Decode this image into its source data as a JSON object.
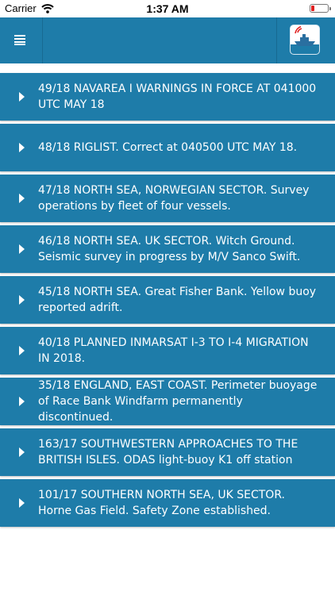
{
  "status": {
    "carrier": "Carrier",
    "time": "1:37 AM"
  },
  "navbar": {
    "menu_icon": "hamburger-menu-icon",
    "logo_icon": "ship-radio-logo-icon"
  },
  "colors": {
    "primary": "#1e7ca9",
    "text": "#ffffff",
    "background": "#ffffff",
    "battery_low": "#e02020"
  },
  "warnings": [
    {
      "text": "49/18 NAVAREA I WARNINGS IN FORCE AT 041000 UTC MAY 18"
    },
    {
      "text": "48/18 RIGLIST. Correct at 040500 UTC MAY 18."
    },
    {
      "text": "47/18 NORTH SEA, NORWEGIAN SECTOR. Survey operations by fleet of four vessels."
    },
    {
      "text": "46/18 NORTH SEA. UK SECTOR. Witch Ground. Seismic survey in progress by M/V Sanco Swift."
    },
    {
      "text": "45/18 NORTH SEA. Great Fisher Bank. Yellow buoy reported adrift."
    },
    {
      "text": "40/18 PLANNED INMARSAT I-3 TO I-4 MIGRATION IN 2018."
    },
    {
      "text": "35/18 ENGLAND, EAST COAST. Perimeter buoyage of Race Bank Windfarm permanently discontinued."
    },
    {
      "text": "163/17 SOUTHWESTERN APPROACHES TO THE BRITISH ISLES. ODAS light-buoy K1 off station"
    },
    {
      "text": "101/17 SOUTHERN NORTH SEA, UK SECTOR. Horne Gas Field. Safety Zone established."
    }
  ]
}
